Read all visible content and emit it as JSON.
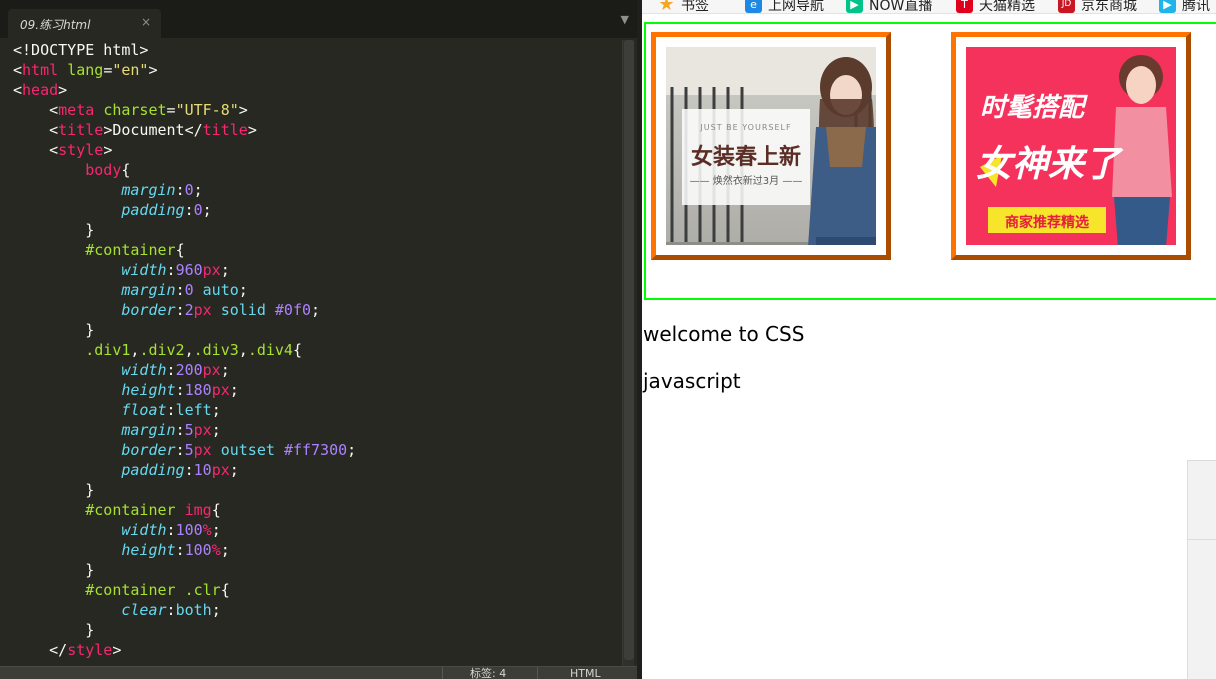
{
  "editor": {
    "tab_title": "09.练习html",
    "close_glyph": "×",
    "menu_glyph": "▼",
    "code_lines": [
      [
        {
          "t": "<!DOCTYPE html>",
          "c": "#f8f8f2"
        }
      ],
      [
        {
          "t": "<",
          "c": "#f8f8f2"
        },
        {
          "t": "html",
          "c": "#f92672"
        },
        {
          "t": " ",
          "c": "#f8f8f2"
        },
        {
          "t": "lang",
          "c": "#a6e22e"
        },
        {
          "t": "=",
          "c": "#f8f8f2"
        },
        {
          "t": "\"en\"",
          "c": "#e6db74"
        },
        {
          "t": ">",
          "c": "#f8f8f2"
        }
      ],
      [
        {
          "t": "<",
          "c": "#f8f8f2"
        },
        {
          "t": "head",
          "c": "#f92672"
        },
        {
          "t": ">",
          "c": "#f8f8f2"
        }
      ],
      [
        {
          "t": "    <",
          "c": "#f8f8f2"
        },
        {
          "t": "meta",
          "c": "#f92672"
        },
        {
          "t": " ",
          "c": "#f8f8f2"
        },
        {
          "t": "charset",
          "c": "#a6e22e"
        },
        {
          "t": "=",
          "c": "#f8f8f2"
        },
        {
          "t": "\"UTF-8\"",
          "c": "#e6db74"
        },
        {
          "t": ">",
          "c": "#f8f8f2"
        }
      ],
      [
        {
          "t": "    <",
          "c": "#f8f8f2"
        },
        {
          "t": "title",
          "c": "#f92672"
        },
        {
          "t": ">Document</",
          "c": "#f8f8f2"
        },
        {
          "t": "title",
          "c": "#f92672"
        },
        {
          "t": ">",
          "c": "#f8f8f2"
        }
      ],
      [
        {
          "t": "    <",
          "c": "#f8f8f2"
        },
        {
          "t": "style",
          "c": "#f92672"
        },
        {
          "t": ">",
          "c": "#f8f8f2"
        }
      ],
      [
        {
          "t": "        ",
          "c": "#f8f8f2"
        },
        {
          "t": "body",
          "c": "#f92672"
        },
        {
          "t": "{",
          "c": "#f8f8f2"
        }
      ],
      [
        {
          "t": "            ",
          "c": "#f8f8f2"
        },
        {
          "t": "margin",
          "c": "#66d9ef",
          "i": true
        },
        {
          "t": ":",
          "c": "#f8f8f2"
        },
        {
          "t": "0",
          "c": "#ae81ff"
        },
        {
          "t": ";",
          "c": "#f8f8f2"
        }
      ],
      [
        {
          "t": "            ",
          "c": "#f8f8f2"
        },
        {
          "t": "padding",
          "c": "#66d9ef",
          "i": true
        },
        {
          "t": ":",
          "c": "#f8f8f2"
        },
        {
          "t": "0",
          "c": "#ae81ff"
        },
        {
          "t": ";",
          "c": "#f8f8f2"
        }
      ],
      [
        {
          "t": "        }",
          "c": "#f8f8f2"
        }
      ],
      [
        {
          "t": "        ",
          "c": "#f8f8f2"
        },
        {
          "t": "#container",
          "c": "#a6e22e"
        },
        {
          "t": "{",
          "c": "#f8f8f2"
        }
      ],
      [
        {
          "t": "            ",
          "c": "#f8f8f2"
        },
        {
          "t": "width",
          "c": "#66d9ef",
          "i": true
        },
        {
          "t": ":",
          "c": "#f8f8f2"
        },
        {
          "t": "960",
          "c": "#ae81ff"
        },
        {
          "t": "px",
          "c": "#f92672"
        },
        {
          "t": ";",
          "c": "#f8f8f2"
        }
      ],
      [
        {
          "t": "            ",
          "c": "#f8f8f2"
        },
        {
          "t": "margin",
          "c": "#66d9ef",
          "i": true
        },
        {
          "t": ":",
          "c": "#f8f8f2"
        },
        {
          "t": "0",
          "c": "#ae81ff"
        },
        {
          "t": " ",
          "c": "#f8f8f2"
        },
        {
          "t": "auto",
          "c": "#66d9ef"
        },
        {
          "t": ";",
          "c": "#f8f8f2"
        }
      ],
      [
        {
          "t": "            ",
          "c": "#f8f8f2"
        },
        {
          "t": "border",
          "c": "#66d9ef",
          "i": true
        },
        {
          "t": ":",
          "c": "#f8f8f2"
        },
        {
          "t": "2",
          "c": "#ae81ff"
        },
        {
          "t": "px",
          "c": "#f92672"
        },
        {
          "t": " ",
          "c": "#f8f8f2"
        },
        {
          "t": "solid",
          "c": "#66d9ef"
        },
        {
          "t": " ",
          "c": "#f8f8f2"
        },
        {
          "t": "#0f0",
          "c": "#ae81ff"
        },
        {
          "t": ";",
          "c": "#f8f8f2"
        }
      ],
      [
        {
          "t": "        }",
          "c": "#f8f8f2"
        }
      ],
      [
        {
          "t": "        ",
          "c": "#f8f8f2"
        },
        {
          "t": ".div1",
          "c": "#a6e22e"
        },
        {
          "t": ",",
          "c": "#f8f8f2"
        },
        {
          "t": ".div2",
          "c": "#a6e22e"
        },
        {
          "t": ",",
          "c": "#f8f8f2"
        },
        {
          "t": ".div3",
          "c": "#a6e22e"
        },
        {
          "t": ",",
          "c": "#f8f8f2"
        },
        {
          "t": ".div4",
          "c": "#a6e22e"
        },
        {
          "t": "{",
          "c": "#f8f8f2"
        }
      ],
      [
        {
          "t": "            ",
          "c": "#f8f8f2"
        },
        {
          "t": "width",
          "c": "#66d9ef",
          "i": true
        },
        {
          "t": ":",
          "c": "#f8f8f2"
        },
        {
          "t": "200",
          "c": "#ae81ff"
        },
        {
          "t": "px",
          "c": "#f92672"
        },
        {
          "t": ";",
          "c": "#f8f8f2"
        }
      ],
      [
        {
          "t": "            ",
          "c": "#f8f8f2"
        },
        {
          "t": "height",
          "c": "#66d9ef",
          "i": true
        },
        {
          "t": ":",
          "c": "#f8f8f2"
        },
        {
          "t": "180",
          "c": "#ae81ff"
        },
        {
          "t": "px",
          "c": "#f92672"
        },
        {
          "t": ";",
          "c": "#f8f8f2"
        }
      ],
      [
        {
          "t": "            ",
          "c": "#f8f8f2"
        },
        {
          "t": "float",
          "c": "#66d9ef",
          "i": true
        },
        {
          "t": ":",
          "c": "#f8f8f2"
        },
        {
          "t": "left",
          "c": "#66d9ef"
        },
        {
          "t": ";",
          "c": "#f8f8f2"
        }
      ],
      [
        {
          "t": "            ",
          "c": "#f8f8f2"
        },
        {
          "t": "margin",
          "c": "#66d9ef",
          "i": true
        },
        {
          "t": ":",
          "c": "#f8f8f2"
        },
        {
          "t": "5",
          "c": "#ae81ff"
        },
        {
          "t": "px",
          "c": "#f92672"
        },
        {
          "t": ";",
          "c": "#f8f8f2"
        }
      ],
      [
        {
          "t": "            ",
          "c": "#f8f8f2"
        },
        {
          "t": "border",
          "c": "#66d9ef",
          "i": true
        },
        {
          "t": ":",
          "c": "#f8f8f2"
        },
        {
          "t": "5",
          "c": "#ae81ff"
        },
        {
          "t": "px",
          "c": "#f92672"
        },
        {
          "t": " ",
          "c": "#f8f8f2"
        },
        {
          "t": "outset",
          "c": "#66d9ef"
        },
        {
          "t": " ",
          "c": "#f8f8f2"
        },
        {
          "t": "#ff7300",
          "c": "#ae81ff"
        },
        {
          "t": ";",
          "c": "#f8f8f2"
        }
      ],
      [
        {
          "t": "            ",
          "c": "#f8f8f2"
        },
        {
          "t": "padding",
          "c": "#66d9ef",
          "i": true
        },
        {
          "t": ":",
          "c": "#f8f8f2"
        },
        {
          "t": "10",
          "c": "#ae81ff"
        },
        {
          "t": "px",
          "c": "#f92672"
        },
        {
          "t": ";",
          "c": "#f8f8f2"
        }
      ],
      [
        {
          "t": "        }",
          "c": "#f8f8f2"
        }
      ],
      [
        {
          "t": "        ",
          "c": "#f8f8f2"
        },
        {
          "t": "#container",
          "c": "#a6e22e"
        },
        {
          "t": " ",
          "c": "#f8f8f2"
        },
        {
          "t": "img",
          "c": "#f92672"
        },
        {
          "t": "{",
          "c": "#f8f8f2"
        }
      ],
      [
        {
          "t": "            ",
          "c": "#f8f8f2"
        },
        {
          "t": "width",
          "c": "#66d9ef",
          "i": true
        },
        {
          "t": ":",
          "c": "#f8f8f2"
        },
        {
          "t": "100",
          "c": "#ae81ff"
        },
        {
          "t": "%",
          "c": "#f92672"
        },
        {
          "t": ";",
          "c": "#f8f8f2"
        }
      ],
      [
        {
          "t": "            ",
          "c": "#f8f8f2"
        },
        {
          "t": "height",
          "c": "#66d9ef",
          "i": true
        },
        {
          "t": ":",
          "c": "#f8f8f2"
        },
        {
          "t": "100",
          "c": "#ae81ff"
        },
        {
          "t": "%",
          "c": "#f92672"
        },
        {
          "t": ";",
          "c": "#f8f8f2"
        }
      ],
      [
        {
          "t": "        }",
          "c": "#f8f8f2"
        }
      ],
      [
        {
          "t": "        ",
          "c": "#f8f8f2"
        },
        {
          "t": "#container",
          "c": "#a6e22e"
        },
        {
          "t": " ",
          "c": "#f8f8f2"
        },
        {
          "t": ".clr",
          "c": "#a6e22e"
        },
        {
          "t": "{",
          "c": "#f8f8f2"
        }
      ],
      [
        {
          "t": "            ",
          "c": "#f8f8f2"
        },
        {
          "t": "clear",
          "c": "#66d9ef",
          "i": true
        },
        {
          "t": ":",
          "c": "#f8f8f2"
        },
        {
          "t": "both",
          "c": "#66d9ef"
        },
        {
          "t": ";",
          "c": "#f8f8f2"
        }
      ],
      [
        {
          "t": "        }",
          "c": "#f8f8f2"
        }
      ],
      [
        {
          "t": "    </",
          "c": "#f8f8f2"
        },
        {
          "t": "style",
          "c": "#f92672"
        },
        {
          "t": ">",
          "c": "#f8f8f2"
        }
      ]
    ],
    "status": {
      "tab_size": "标签: 4",
      "syntax": "HTML"
    }
  },
  "browser": {
    "bookmarks": [
      {
        "label": "书签",
        "icon": "star-icon",
        "color": "#f5a623"
      },
      {
        "label": "上网导航",
        "icon": "ie-icon",
        "color": "#1e88e5"
      },
      {
        "label": "NOW直播",
        "icon": "now-live-icon",
        "color": "#00c389"
      },
      {
        "label": "天猫精选",
        "icon": "tmall-icon",
        "color": "#e0001b"
      },
      {
        "label": "京东商城",
        "icon": "jd-icon",
        "color": "#c91623"
      },
      {
        "label": "腾讯",
        "icon": "tencent-video-icon",
        "color": "#20b5e8"
      }
    ],
    "banner1": {
      "subtitle": "JUST BE YOURSELF",
      "title": "女装春上新",
      "caption": "—— 焕然衣新过3月 ——"
    },
    "banner2": {
      "title_top": "时髦搭配",
      "title_main": "女神来了",
      "ribbon": "商家推荐精选"
    },
    "paragraphs": [
      "welcome to CSS",
      "javascript"
    ],
    "colors": {
      "container_border": "#00ff00",
      "card_border": "#ff7300"
    }
  }
}
